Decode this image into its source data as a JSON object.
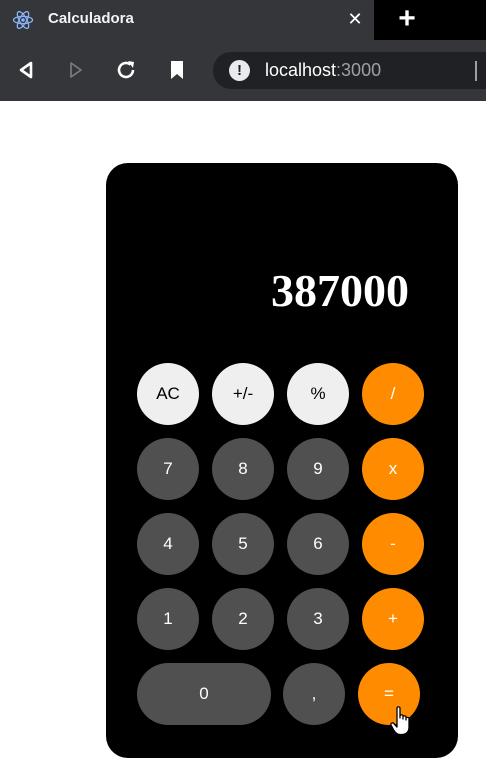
{
  "browser": {
    "tab_title": "Calculadora",
    "tab_icon": "react-atom-icon",
    "close_symbol": "✕",
    "new_tab_symbol": "+",
    "url_host": "localhost",
    "url_port": ":3000"
  },
  "calculator": {
    "display": "387000",
    "keys": {
      "ac": "AC",
      "sign": "+/-",
      "percent": "%",
      "divide": "/",
      "seven": "7",
      "eight": "8",
      "nine": "9",
      "multiply": "x",
      "four": "4",
      "five": "5",
      "six": "6",
      "minus": "-",
      "one": "1",
      "two": "2",
      "three": "3",
      "plus": "+",
      "zero": "0",
      "comma": ",",
      "equals": "="
    }
  },
  "colors": {
    "orange": "#ff8c00",
    "dark_key": "#505050",
    "light_key": "#efefef",
    "calc_bg": "#000000"
  }
}
